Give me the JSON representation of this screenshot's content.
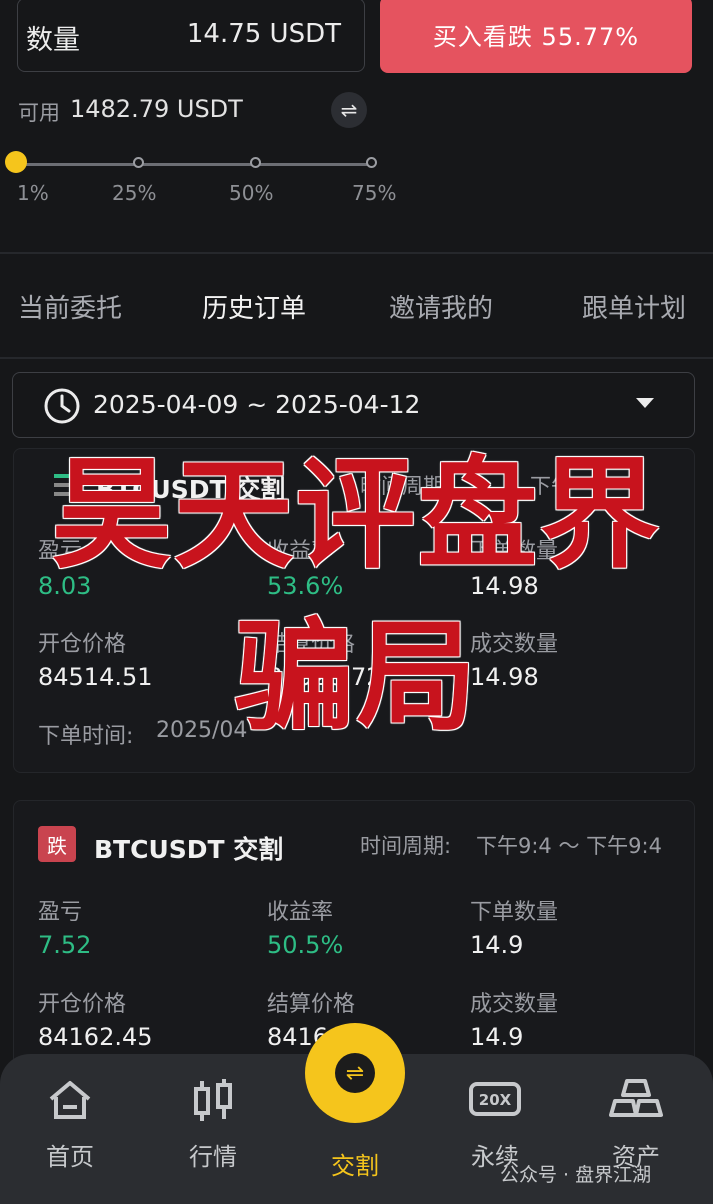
{
  "order_form": {
    "quantity_label": "数量",
    "quantity_value": "14.75 USDT",
    "buy_button": "买入看跌 55.77%",
    "available_label": "可用",
    "available_value": "1482.79 USDT",
    "swap_icon": "⇌",
    "slider_labels": [
      "1%",
      "25%",
      "50%",
      "75%"
    ],
    "slider_percent": 1
  },
  "tabs": [
    "当前委托",
    "历史订单",
    "邀请我的",
    "跟单计划"
  ],
  "active_tab": "历史订单",
  "date_range": "2025-04-09 ~ 2025-04-12",
  "overlay": {
    "line1": "昊天评盘界",
    "line2": "骗局"
  },
  "orders": [
    {
      "pair": "BTCUSDT 交割",
      "period_label": "时间周期:",
      "period": "下午 ~",
      "labels": [
        "盈亏",
        "收益率",
        "下单数量",
        "开仓价格",
        "结算价格",
        "成交数量"
      ],
      "pnl": "8.03",
      "rate": "53.6%",
      "order_qty": "14.98",
      "open_price": "84514.51",
      "settle_price": "84528.72",
      "filled_qty": "14.98",
      "time_label": "下单时间:",
      "time": "2025/04"
    },
    {
      "badge": "跌",
      "pair": "BTCUSDT 交割",
      "period_label": "时间周期:",
      "period": "下午9:4 ～ 下午9:4",
      "labels": [
        "盈亏",
        "收益率",
        "下单数量",
        "开仓价格",
        "结算价格",
        "成交数量"
      ],
      "pnl": "7.52",
      "rate": "50.5%",
      "order_qty": "14.9",
      "open_price": "84162.45",
      "settle_price": "8416",
      "filled_qty": "14.9"
    }
  ],
  "nav": [
    {
      "label": "首页",
      "icon": "home-icon"
    },
    {
      "label": "行情",
      "icon": "market-icon"
    },
    {
      "label": "交割",
      "icon": "trade-icon"
    },
    {
      "label": "永续",
      "icon": "perpetual-icon"
    },
    {
      "label": "资产",
      "icon": "assets-icon"
    }
  ],
  "watermark": "公众号 · 盘界江湖",
  "colors": {
    "accent": "#f5c51c",
    "sell": "#e5535f",
    "profit": "#2ebd85"
  }
}
